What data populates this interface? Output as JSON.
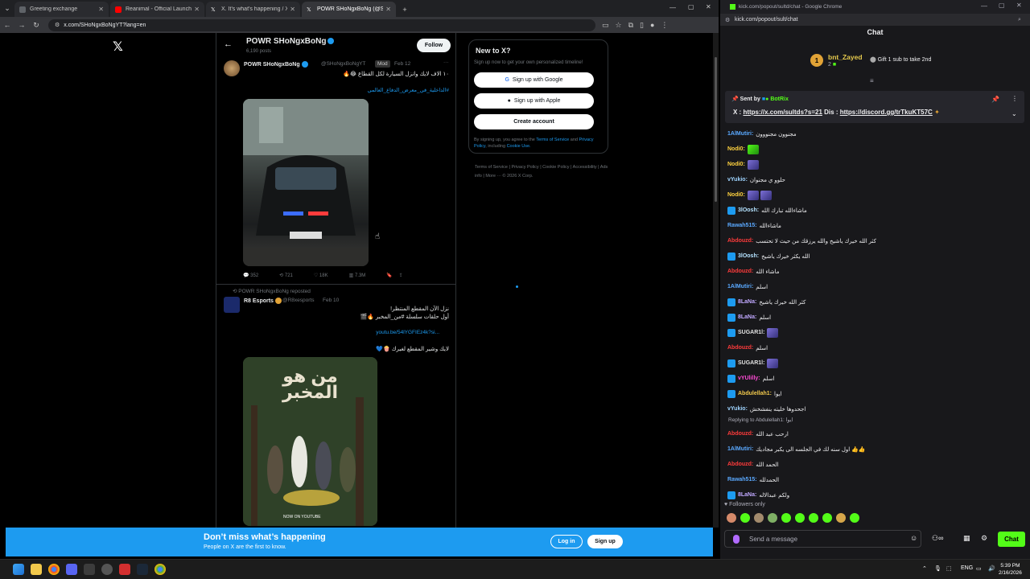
{
  "left_window": {
    "tabs": [
      {
        "title": "Greeting exchange",
        "color": "#5f6368"
      },
      {
        "title": "Reanimal - Official Launch Trailer",
        "color": "#ff0000"
      },
      {
        "title": "X. It's what's happening / X",
        "color": "#000000"
      },
      {
        "title": "POWR SHoNgxBoNg (@SHoNgxBoNgYT) / X",
        "color": "#000000"
      }
    ],
    "url": "x.com/SHoNgxBoNgYT?lang=en"
  },
  "profile": {
    "name": "POWR SHoNgxBoNg",
    "posts": "6,190 posts",
    "follow_label": "Follow"
  },
  "tweets": [
    {
      "author": "POWR SHoNgxBoNg",
      "handle": "@SHoNgxBoNgYT",
      "badge": "Mod",
      "date": "Feb 12",
      "text": "١٠ الاف لايك وانزل السيارة لكل القطاع 😂🔥",
      "hashtag": "#الداخلية_في_معرض_الدفاع_العالمي",
      "actions": {
        "replies": "352",
        "reposts": "721",
        "likes": "18K",
        "views": "7.3M"
      }
    },
    {
      "reposted_by": "POWR SHoNgxBoNg reposted",
      "author": "R8 Esports",
      "handle": "@R8xesports",
      "date": "Feb 10",
      "line1": "نزل الآن المقطع المنتظر!",
      "line2": "أول حلقات سلسلة #من_المخبر 🔥🎬",
      "link": "youtu.be/54lYGFIEz4k?si...",
      "line3": "لايك وشير المقطع لغيرك 🍿💙",
      "poster_title": "من هو المخبر",
      "poster_footer": "NOW ON YOUTUBE"
    }
  ],
  "signup_box": {
    "title": "New to X?",
    "subtitle": "Sign up now to get your own personalized timeline!",
    "google": "Sign up with Google",
    "apple": "Sign up with Apple",
    "create": "Create account",
    "terms_prefix": "By signing up, you agree to the",
    "terms_link": "Terms of Service",
    "and": "and",
    "privacy_link": "Privacy Policy",
    "including": ", including",
    "cookie_link": "Cookie Use."
  },
  "footer_links": "Terms of Service | Privacy Policy | Cookie Policy | Accessibility | Ads info | More ··· © 2026 X Corp.",
  "banner": {
    "title": "Don’t miss what’s happening",
    "subtitle": "People on X are the first to know.",
    "login": "Log in",
    "signup": "Sign up"
  },
  "right_window": {
    "title": "kick.com/popout/sultd/chat - Google Chrome",
    "url": "kick.com/popout/sult/chat",
    "chat_header": "Chat",
    "top_gifter": {
      "rank": "1",
      "name": "bnt_Zayed",
      "count": "2",
      "gift_text": "Gift 1 sub to take 2nd"
    },
    "pinned": {
      "sent_by": "Sent by",
      "bot": "BotRix",
      "prefix_x": "X : ",
      "x_link": "https://x.com/sultds?s=21",
      "dis": " Dis : ",
      "dis_link": "https://discord.gg/trTkuKT57C"
    },
    "messages": [
      {
        "user": "1AlMutiri",
        "color": "#5aa9ff",
        "text": "مجنوون مجنووون"
      },
      {
        "user": "Nodi0",
        "color": "#ffd23f",
        "text": ""
      },
      {
        "user": "Nodi0",
        "color": "#ffd23f",
        "text": ""
      },
      {
        "user": "vYukio",
        "color": "#9fd4ff",
        "text": "حلوو ي مجنوان"
      },
      {
        "user": "Nodi0",
        "color": "#ffd23f",
        "text": ""
      },
      {
        "user": "3lOosh",
        "color": "#b5e3ff",
        "text": "ماشاءالله تبارك الله"
      },
      {
        "user": "Rawah515",
        "color": "#5aa9ff",
        "text": "ماشاءالله"
      },
      {
        "user": "Abdouzd",
        "color": "#ff3b3b",
        "text": "كثر الله خيرك ياشيخ والله يرزقك من حيث لا تحتسب"
      },
      {
        "user": "3lOosh",
        "color": "#b5e3ff",
        "text": "الله يكثر خيرك ياشيخ"
      },
      {
        "user": "Abdouzd",
        "color": "#ff3b3b",
        "text": "ماشاء الله"
      },
      {
        "user": "1AlMutiri",
        "color": "#5aa9ff",
        "text": "اسلم"
      },
      {
        "user": "8LaNa",
        "color": "#c0a8ff",
        "text": "كثر الله خيرك ياشيخ"
      },
      {
        "user": "8LaNa",
        "color": "#c0a8ff",
        "text": "اسلم"
      },
      {
        "user": "SUGAR1l",
        "color": "#e0e0e0",
        "text": ""
      },
      {
        "user": "Abdouzd",
        "color": "#ff3b3b",
        "text": "اسلم"
      },
      {
        "user": "SUGAR1l",
        "color": "#e0e0e0",
        "text": ""
      },
      {
        "user": "vYUlilly",
        "color": "#ff4ad6",
        "text": "اسلم"
      },
      {
        "user": "Abdulellah1",
        "color": "#f2c94c",
        "text": "ايوا"
      },
      {
        "user": "vYukio",
        "color": "#9fd4ff",
        "text": "اجحدوها خليته ينفشخش"
      },
      {
        "user": "Abdouzd",
        "color": "#ff3b3b",
        "text": "ارحب عبد الله"
      },
      {
        "user": "1AlMutiri",
        "color": "#5aa9ff",
        "text": "اول سنه لك في الجلسه الى يكبر مجاديك 👍👍"
      },
      {
        "user": "Abdouzd",
        "color": "#ff3b3b",
        "text": "الحمد الله"
      },
      {
        "user": "Rawah515",
        "color": "#5aa9ff",
        "text": "الحمدلله"
      },
      {
        "user": "8LaNa",
        "color": "#c0a8ff",
        "text": "ولكم عبدالاله"
      }
    ],
    "reply_label": "Replying to Abdulellah1: ايوا",
    "followers_only": "Followers only",
    "input_placeholder": "Send a message",
    "chat_button": "Chat"
  },
  "taskbar": {
    "lang": "ENG",
    "time": "5:39 PM",
    "date": "2/16/2026"
  }
}
